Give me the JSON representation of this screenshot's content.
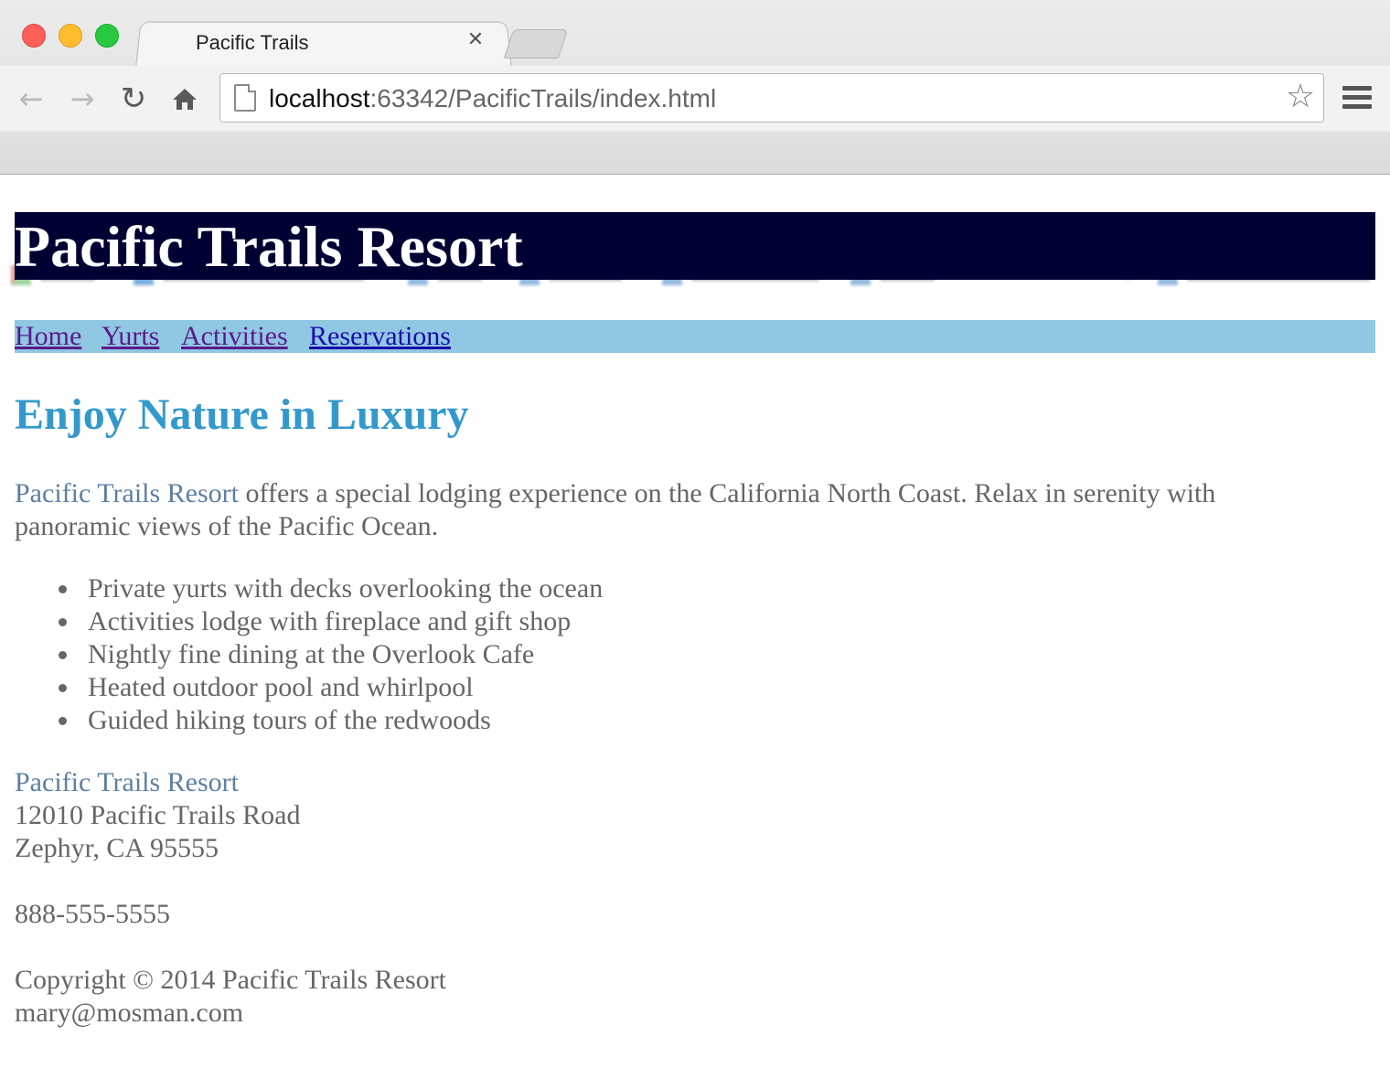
{
  "browser": {
    "tab_title": "Pacific Trails",
    "tab_close_glyph": "✕",
    "url_host": "localhost",
    "url_rest": ":63342/PacificTrails/index.html",
    "icons": {
      "back": "back-arrow-icon",
      "forward": "forward-arrow-icon",
      "reload": "reload-icon",
      "home": "home-icon",
      "bookmark_star": "star-icon",
      "menu": "hamburger-menu-icon"
    }
  },
  "site": {
    "title": "Pacific Trails Resort",
    "nav": [
      {
        "label": "Home"
      },
      {
        "label": "Yurts"
      },
      {
        "label": "Activities"
      },
      {
        "label": "Reservations"
      }
    ],
    "heading": "Enjoy Nature in Luxury",
    "intro_name": "Pacific Trails Resort",
    "intro_text": " offers a special lodging experience on the California North Coast. Relax in serenity with panoramic views of the Pacific Ocean.",
    "features": [
      "Private yurts with decks overlooking the ocean",
      "Activities lodge with fireplace and gift shop",
      "Nightly fine dining at the Overlook Cafe",
      "Heated outdoor pool and whirlpool",
      "Guided hiking tours of the redwoods"
    ],
    "contact": {
      "name": "Pacific Trails Resort",
      "street": "12010 Pacific Trails Road",
      "city": "Zephyr, CA 95555",
      "phone": "888-555-5555"
    },
    "footer": {
      "copyright": "Copyright © 2014 Pacific Trails Resort",
      "email": "mary@mosman.com"
    }
  },
  "colors": {
    "header_bg": "#000033",
    "nav_bg": "#90c7e3",
    "heading": "#3399cc",
    "resort_name": "#5c7fa3",
    "body_text": "#666666"
  }
}
